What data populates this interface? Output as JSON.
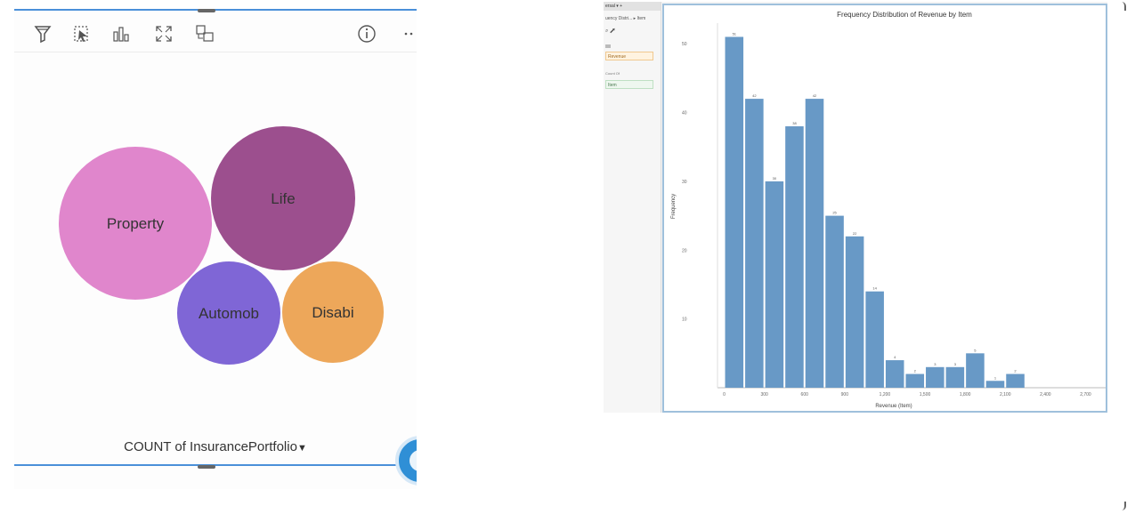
{
  "left_panel": {
    "toolbar": {
      "icons": [
        "filter-icon",
        "select-icon",
        "chart-type-icon",
        "expand-icon",
        "flip-card-icon",
        "info-icon",
        "more-icon"
      ]
    },
    "bubbles": [
      {
        "label": "Property",
        "color": "#e086cc"
      },
      {
        "label": "Life",
        "color": "#9c4f8e"
      },
      {
        "label": "Automob",
        "color": "#7f66d6"
      },
      {
        "label": "Disabi",
        "color": "#eda75a"
      }
    ],
    "count_label": "COUNT of InsurancePortfolio"
  },
  "right_panel": {
    "side": {
      "tabs": "ersal  ▾  +",
      "row1": "uency Distri...  ▸ Item",
      "row2": "⌕  ⬈",
      "field_a": "Revenue",
      "field_b_label": "Count Of",
      "field_b": "Item"
    },
    "chart_data": {
      "type": "bar",
      "title": "Frequency Distribution of Revenue by Item",
      "xlabel": "Revenue (Item)",
      "ylabel": "Frequency",
      "bar_color": "#6899c6",
      "x_ticks": [
        "0",
        "300",
        "600",
        "900",
        "1,200",
        "1,500",
        "1,800",
        "2,100",
        "2,400",
        "2,700"
      ],
      "y_ticks": [
        "10",
        "20",
        "30",
        "40",
        "50"
      ],
      "ylim": [
        0,
        53
      ],
      "bins": [
        0,
        150,
        300,
        450,
        600,
        750,
        900,
        1050,
        1200,
        1350,
        1500,
        1650,
        1800,
        1950,
        2100,
        2250,
        2400,
        2550,
        2700
      ],
      "values": [
        51,
        42,
        30,
        38,
        42,
        25,
        22,
        14,
        4,
        2,
        3,
        3,
        5,
        1,
        2
      ],
      "bar_labels": [
        "51",
        "42",
        "30",
        "38",
        "42",
        "25",
        "22",
        "14",
        "4",
        "2",
        "3",
        "3",
        "5",
        "1",
        "2"
      ]
    }
  }
}
